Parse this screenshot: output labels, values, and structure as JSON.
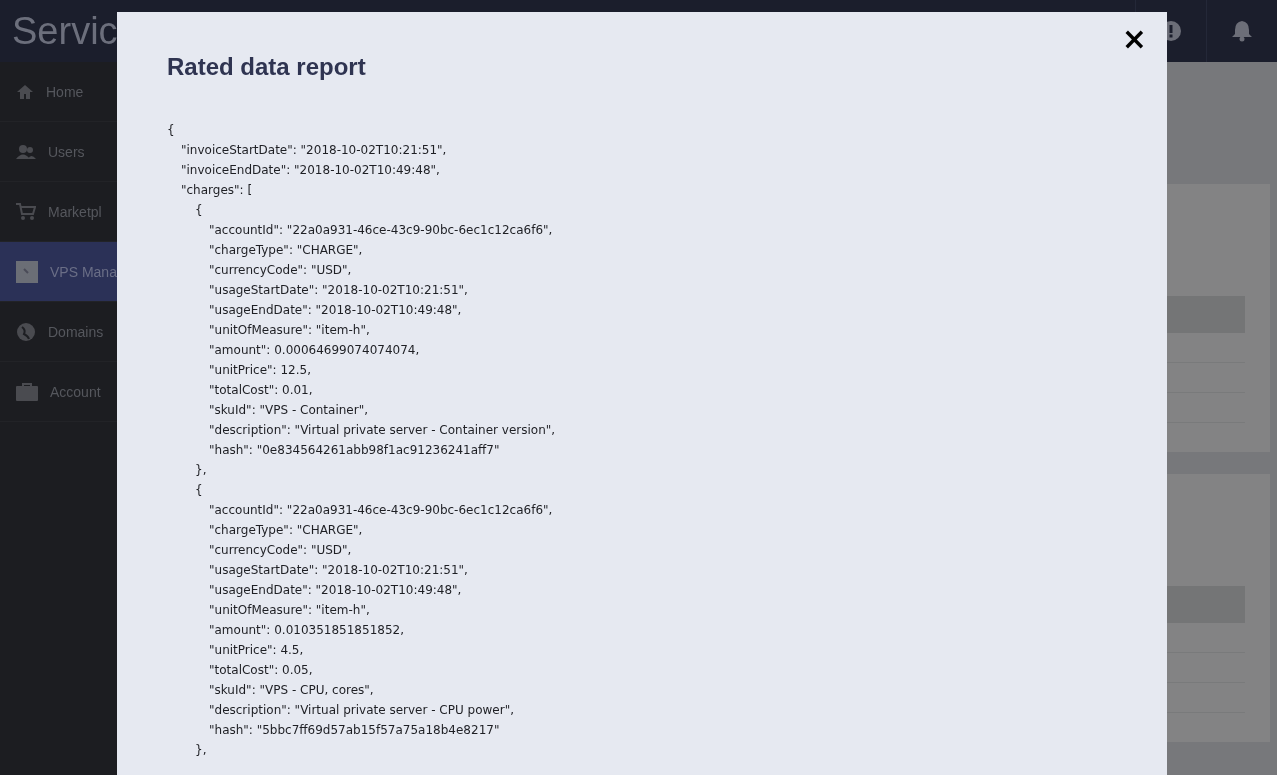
{
  "header": {
    "title": "Servic"
  },
  "sidebar": {
    "items": [
      {
        "label": "Home",
        "selected": false
      },
      {
        "label": "Users",
        "selected": false
      },
      {
        "label": "Marketpl",
        "selected": false
      },
      {
        "label": "VPS Mana",
        "selected": true
      },
      {
        "label": "Domains",
        "selected": false
      },
      {
        "label": "Account",
        "selected": false
      }
    ]
  },
  "modal": {
    "title": "Rated data report",
    "close": "×",
    "report": [
      {
        "open": "{",
        "children": [
          {
            "text": "\"invoiceStartDate\": \"2018-10-02T10:21:51\","
          },
          {
            "text": "\"invoiceEndDate\": \"2018-10-02T10:49:48\","
          },
          {
            "open": "\"charges\": [",
            "children": [
              {
                "open": "{",
                "close": "},",
                "children": [
                  {
                    "text": "\"accountId\": \"22a0a931-46ce-43c9-90bc-6ec1c12ca6f6\","
                  },
                  {
                    "text": "\"chargeType\": \"CHARGE\","
                  },
                  {
                    "text": "\"currencyCode\": \"USD\","
                  },
                  {
                    "text": "\"usageStartDate\": \"2018-10-02T10:21:51\","
                  },
                  {
                    "text": "\"usageEndDate\": \"2018-10-02T10:49:48\","
                  },
                  {
                    "text": "\"unitOfMeasure\": \"item-h\","
                  },
                  {
                    "text": "\"amount\": 0.00064699074074074,"
                  },
                  {
                    "text": "\"unitPrice\": 12.5,"
                  },
                  {
                    "text": "\"totalCost\": 0.01,"
                  },
                  {
                    "text": "\"skuId\": \"VPS - Container\","
                  },
                  {
                    "text": "\"description\": \"Virtual private server - Container version\","
                  },
                  {
                    "text": "\"hash\": \"0e834564261abb98f1ac91236241aff7\""
                  }
                ]
              },
              {
                "open": "{",
                "close": "},",
                "children": [
                  {
                    "text": "\"accountId\": \"22a0a931-46ce-43c9-90bc-6ec1c12ca6f6\","
                  },
                  {
                    "text": "\"chargeType\": \"CHARGE\","
                  },
                  {
                    "text": "\"currencyCode\": \"USD\","
                  },
                  {
                    "text": "\"usageStartDate\": \"2018-10-02T10:21:51\","
                  },
                  {
                    "text": "\"usageEndDate\": \"2018-10-02T10:49:48\","
                  },
                  {
                    "text": "\"unitOfMeasure\": \"item-h\","
                  },
                  {
                    "text": "\"amount\": 0.010351851851852,"
                  },
                  {
                    "text": "\"unitPrice\": 4.5,"
                  },
                  {
                    "text": "\"totalCost\": 0.05,"
                  },
                  {
                    "text": "\"skuId\": \"VPS - CPU, cores\","
                  },
                  {
                    "text": "\"description\": \"Virtual private server - CPU power\","
                  },
                  {
                    "text": "\"hash\": \"5bbc7ff69d57ab15f57a75a18b4e8217\""
                  }
                ]
              }
            ]
          }
        ]
      }
    ]
  }
}
